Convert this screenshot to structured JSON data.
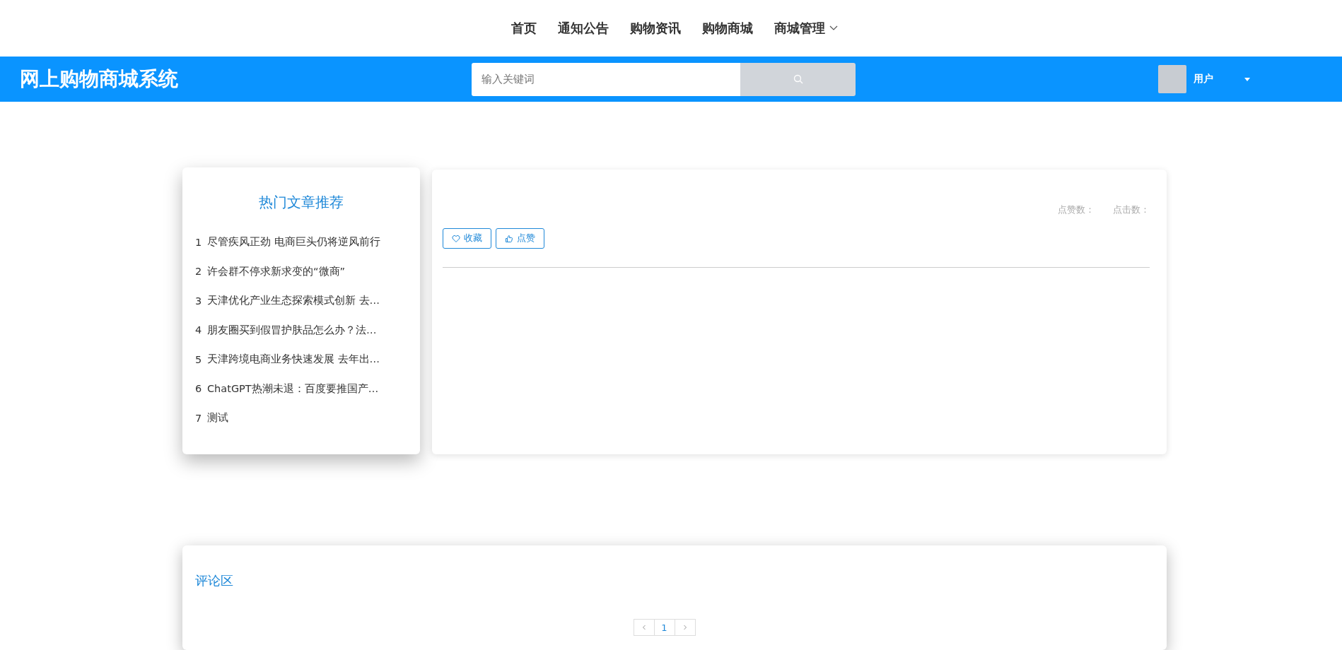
{
  "nav": {
    "items": [
      {
        "label": "首页",
        "dropdown": false
      },
      {
        "label": "通知公告",
        "dropdown": false
      },
      {
        "label": "购物资讯",
        "dropdown": false
      },
      {
        "label": "购物商城",
        "dropdown": false
      },
      {
        "label": "商城管理",
        "dropdown": true
      }
    ]
  },
  "header": {
    "logo": "网上购物商城系统",
    "search": {
      "placeholder": "输入关键词"
    },
    "user": {
      "name": "用户"
    }
  },
  "hot_articles": {
    "title": "热门文章推荐",
    "items": [
      {
        "rank": "1",
        "title": "尽管疾风正劲 电商巨头仍将逆风前行"
      },
      {
        "rank": "2",
        "title": "许会群不停求新求变的“微商”"
      },
      {
        "rank": "3",
        "title": "天津优化产业生态探索模式创新 去…"
      },
      {
        "rank": "4",
        "title": "朋友圈买到假冒护肤品怎么办？法…"
      },
      {
        "rank": "5",
        "title": "天津跨境电商业务快速发展 去年出…"
      },
      {
        "rank": "6",
        "title": "ChatGPT热潮未退：百度要推国产…"
      },
      {
        "rank": "7",
        "title": "测试"
      }
    ]
  },
  "article": {
    "stats": [
      "点赞数：",
      "点击数："
    ],
    "buttons": [
      {
        "label": "收藏"
      },
      {
        "label": "点赞"
      }
    ]
  },
  "comments": {
    "title": "评论区",
    "pagination": {
      "pages": [
        {
          "label": "1",
          "selected": true
        }
      ]
    }
  }
}
